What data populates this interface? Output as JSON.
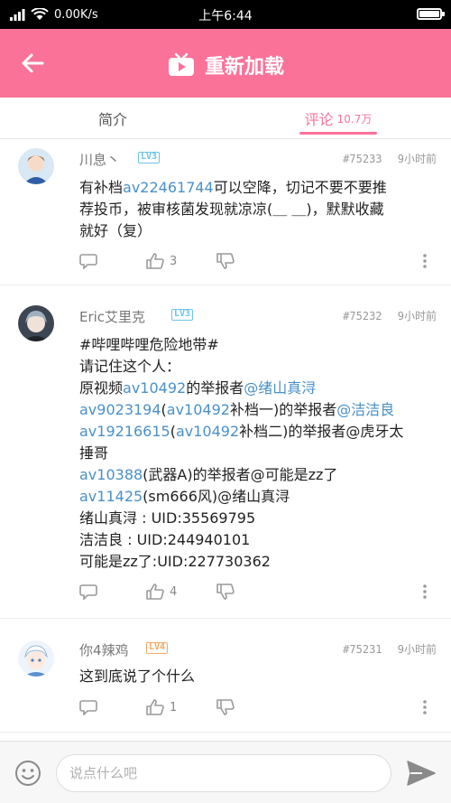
{
  "status_bar": {
    "speed": "0.00K/s",
    "time": "上午6:44"
  },
  "header": {
    "title": "重新加载",
    "back_icon": "arrow-left-icon",
    "tv_icon": "tv-icon"
  },
  "tabs": [
    {
      "label": "简介",
      "active": false
    },
    {
      "label": "评论",
      "count": "10.7万",
      "active": true
    }
  ],
  "comments": [
    {
      "username": "川息丶",
      "level": "LV3",
      "floor": "#75233",
      "time": "9小时前",
      "content_lines": [
        [
          {
            "t": "有补档"
          },
          {
            "t": "av22461744",
            "link": true
          },
          {
            "t": "可以空降，切记不要不要推"
          }
        ],
        [
          {
            "t": "荐投币，被审核菌发现就凉凉(＿ ＿)，默默收藏"
          }
        ],
        [
          {
            "t": "就好（复）"
          }
        ]
      ],
      "likes": "3"
    },
    {
      "username": "Eric艾里克",
      "level": "LV3",
      "floor": "#75232",
      "time": "9小时前",
      "content_lines": [
        [
          {
            "t": "#哔哩哔哩危险地带#"
          }
        ],
        [
          {
            "t": "请记住这个人："
          }
        ],
        [
          {
            "t": "原视频"
          },
          {
            "t": "av10492",
            "link": true
          },
          {
            "t": "的举报者"
          },
          {
            "t": "@绪山真浔",
            "link": true
          }
        ],
        [
          {
            "t": "av9023194",
            "link": true
          },
          {
            "t": "("
          },
          {
            "t": "av10492",
            "link": true
          },
          {
            "t": "补档一)的举报者"
          },
          {
            "t": "@洁洁良",
            "link": true
          }
        ],
        [
          {
            "t": "av19216615",
            "link": true
          },
          {
            "t": "("
          },
          {
            "t": "av10492",
            "link": true
          },
          {
            "t": "补档二)的举报者@虎牙太"
          }
        ],
        [
          {
            "t": "捶哥"
          }
        ],
        [
          {
            "t": "av10388",
            "link": true
          },
          {
            "t": "(武器A)的举报者@可能是zz了"
          }
        ],
        [
          {
            "t": "av11425",
            "link": true
          },
          {
            "t": "(sm666风)@绪山真浔"
          }
        ],
        [
          {
            "t": "绪山真浔   :  UID:35569795"
          }
        ],
        [
          {
            "t": "洁洁良       :  UID:244940101"
          }
        ],
        [
          {
            "t": "可能是zz了:UID:227730362"
          }
        ]
      ],
      "likes": "4"
    },
    {
      "username": "你4辣鸡",
      "level": "LV4",
      "floor": "#75231",
      "time": "9小时前",
      "content_lines": [
        [
          {
            "t": "这到底说了个什么"
          }
        ]
      ],
      "likes": "1"
    }
  ],
  "composer": {
    "placeholder": "说点什么吧",
    "emoji_icon": "smiley-icon",
    "send_icon": "send-icon"
  },
  "colors": {
    "accent": "#fb7299",
    "link": "#4a90c9",
    "level3": "#6cc5e6",
    "level4": "#f5a962"
  }
}
